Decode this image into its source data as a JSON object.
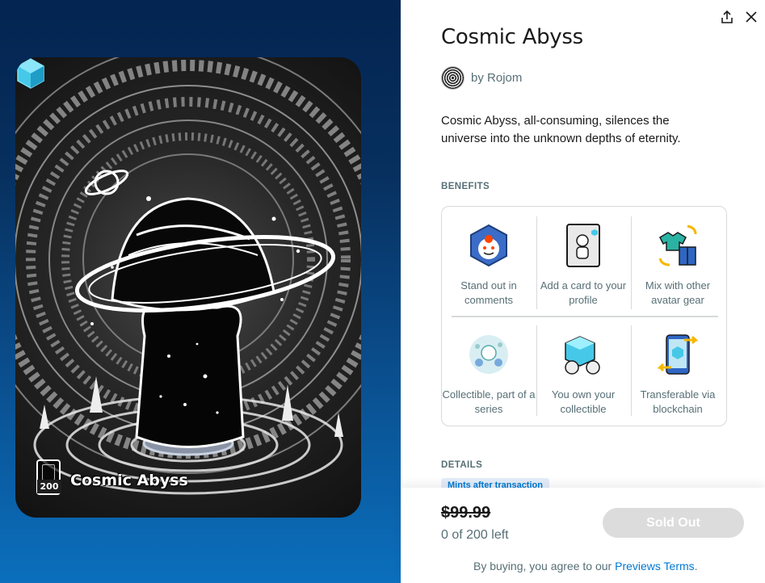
{
  "product": {
    "title": "Cosmic Abyss",
    "creator_prefix": "by",
    "creator_name": "Rojom",
    "description": "Cosmic Abyss, all-consuming, silences the universe into the unknown depths of eternity."
  },
  "card": {
    "title": "Cosmic Abyss",
    "edition_count": "200"
  },
  "benefits": {
    "label": "BENEFITS",
    "items": [
      {
        "label": "Stand out in comments",
        "icon": "snoo-badge-icon"
      },
      {
        "label": "Add a card to your profile",
        "icon": "profile-card-icon"
      },
      {
        "label": "Mix with other avatar gear",
        "icon": "avatar-gear-icon"
      },
      {
        "label": "Collectible, part of a series",
        "icon": "collectible-series-icon"
      },
      {
        "label": "You own your collectible",
        "icon": "gem-ownership-icon"
      },
      {
        "label": "Transferable via blockchain",
        "icon": "blockchain-transfer-icon"
      }
    ]
  },
  "details": {
    "label": "DETAILS",
    "chip": "Mints after transaction"
  },
  "footer": {
    "price": "$99.99",
    "stock": "0 of 200 left",
    "button": "Sold Out",
    "terms_prefix": "By buying, you agree to our",
    "terms_link": "Previews Terms",
    "terms_suffix": "."
  },
  "colors": {
    "accent": "#0079d3",
    "panel_gradient_top": "#042451",
    "panel_gradient_bottom": "#0b6fbd",
    "disabled_button": "#dcdcdc"
  }
}
